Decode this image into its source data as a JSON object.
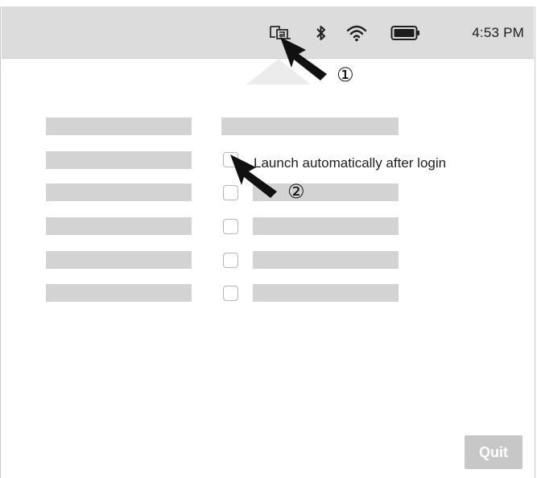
{
  "menubar": {
    "time": "4:53 PM",
    "icons": [
      "app-status-icon",
      "bluetooth-icon",
      "wifi-icon",
      "battery-icon"
    ]
  },
  "settings": {
    "launch_label": "Launch automatically after login",
    "launch_checked": false
  },
  "annotations": {
    "marker_1": "①",
    "marker_2": "②"
  },
  "footer": {
    "quit_label": "Quit"
  },
  "colors": {
    "menubar_bg": "#dcdcdc",
    "placeholder": "#d3d3d3",
    "quit_bg": "#c7c7c7"
  }
}
